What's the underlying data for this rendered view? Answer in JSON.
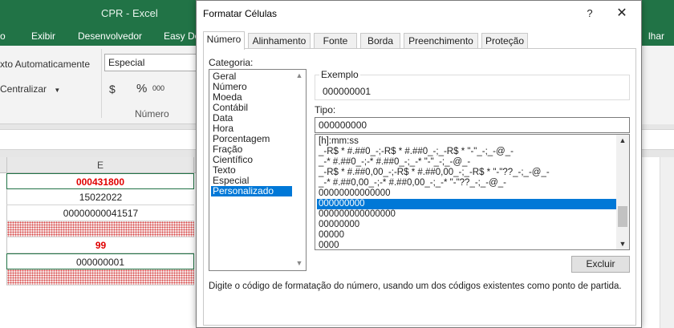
{
  "excel": {
    "title": "CPR - Excel",
    "tabs": [
      "o",
      "Exibir",
      "Desenvolvedor",
      "Easy Do",
      "lhar"
    ],
    "ribbon": {
      "wrap_text": "xto Automaticamente",
      "merge_center": "Centralizar",
      "number_format": "Especial",
      "currency_symbol": "$",
      "percent_symbol": "%",
      "thousands_symbol": "000",
      "group_label": "Número"
    },
    "column_header": "E",
    "cells": [
      "000431800",
      "15022022",
      "00000000041517",
      "",
      "99",
      "000000001",
      ""
    ]
  },
  "dialog": {
    "title": "Formatar Células",
    "help": "?",
    "close": "✕",
    "tabs": [
      "Número",
      "Alinhamento",
      "Fonte",
      "Borda",
      "Preenchimento",
      "Proteção"
    ],
    "category_label": "Categoria:",
    "categories": [
      "Geral",
      "Número",
      "Moeda",
      "Contábil",
      "Data",
      "Hora",
      "Porcentagem",
      "Fração",
      "Científico",
      "Texto",
      "Especial",
      "Personalizado"
    ],
    "selected_category": "Personalizado",
    "sample_label": "Exemplo",
    "sample_value": "000000001",
    "type_label": "Tipo:",
    "type_value": "000000000",
    "formats": [
      "[h]:mm:ss",
      "_-R$ * #.##0_-;-R$ * #.##0_-;_-R$ * \"-\"_-;_-@_-",
      "_-* #.##0_-;-* #.##0_-;_-* \"-\"_-;_-@_-",
      "_-R$ * #.##0,00_-;-R$ * #.##0,00_-;_-R$ * \"-\"??_-;_-@_-",
      "_-* #.##0,00_-;-* #.##0,00_-;_-* \"-\"??_-;_-@_-",
      "00000000000000",
      "000000000",
      "000000000000000",
      "00000000",
      "00000",
      "0000"
    ],
    "selected_format": "000000000",
    "delete_button": "Excluir",
    "hint": "Digite o código de formatação do número, usando um dos códigos existentes como ponto de partida."
  }
}
